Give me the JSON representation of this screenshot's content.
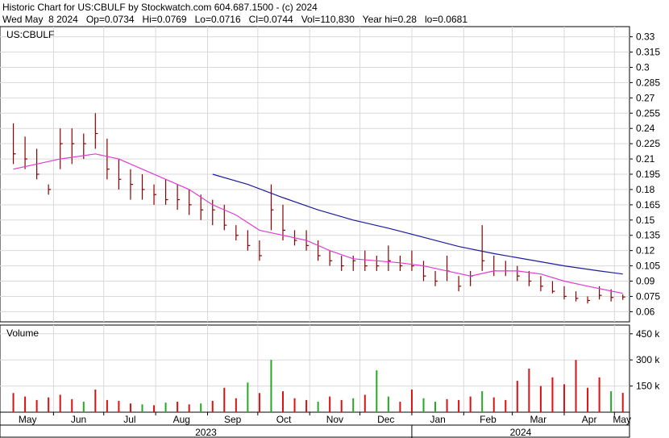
{
  "header": {
    "title": "Historic Chart for US:CBULF by Stockwatch.com 604.687.1500 - (c) 2024",
    "stats": "Wed May  8 2024   Op=0.0734   Hi=0.0769   Lo=0.0716   Cl=0.0744   Vol=110,830   Year hi=0.28   lo=0.0681"
  },
  "colors": {
    "price_bar": "#8b0000",
    "ma_short": "#e03cd0",
    "ma_long": "#1c1c9c",
    "vol_up": "#22aa22",
    "vol_down": "#dd1111",
    "grid": "#d9d9d9"
  },
  "chart_data": [
    {
      "type": "line",
      "panel_label": "US:CBULF",
      "ylim": [
        0.05,
        0.34
      ],
      "yticks": [
        "0.33",
        "0.315",
        "0.3",
        "0.285",
        "0.27",
        "0.255",
        "0.24",
        "0.225",
        "0.21",
        "0.195",
        "0.18",
        "0.165",
        "0.15",
        "0.135",
        "0.12",
        "0.105",
        "0.09",
        "0.075",
        "0.06"
      ],
      "series": [
        {
          "kind": "ohlc",
          "x": [
            "2023-05-08",
            "2023-05-15",
            "2023-05-22",
            "2023-05-29",
            "2023-06-05",
            "2023-06-12",
            "2023-06-19",
            "2023-06-26",
            "2023-07-03",
            "2023-07-10",
            "2023-07-17",
            "2023-07-24",
            "2023-07-31",
            "2023-08-07",
            "2023-08-14",
            "2023-08-21",
            "2023-08-28",
            "2023-09-04",
            "2023-09-11",
            "2023-09-18",
            "2023-09-25",
            "2023-10-02",
            "2023-10-09",
            "2023-10-16",
            "2023-10-23",
            "2023-10-30",
            "2023-11-06",
            "2023-11-13",
            "2023-11-20",
            "2023-11-27",
            "2023-12-04",
            "2023-12-11",
            "2023-12-18",
            "2023-12-25",
            "2024-01-01",
            "2024-01-08",
            "2024-01-15",
            "2024-01-22",
            "2024-01-29",
            "2024-02-05",
            "2024-02-12",
            "2024-02-19",
            "2024-02-26",
            "2024-03-04",
            "2024-03-11",
            "2024-03-18",
            "2024-03-25",
            "2024-04-01",
            "2024-04-08",
            "2024-04-15",
            "2024-04-22",
            "2024-04-29",
            "2024-05-06"
          ],
          "high": [
            0.245,
            0.232,
            0.22,
            0.185,
            0.24,
            0.24,
            0.235,
            0.255,
            0.23,
            0.21,
            0.2,
            0.195,
            0.185,
            0.19,
            0.185,
            0.18,
            0.175,
            0.17,
            0.165,
            0.145,
            0.14,
            0.13,
            0.185,
            0.165,
            0.14,
            0.14,
            0.13,
            0.12,
            0.115,
            0.115,
            0.12,
            0.115,
            0.125,
            0.115,
            0.12,
            0.11,
            0.1,
            0.115,
            0.095,
            0.1,
            0.145,
            0.115,
            0.11,
            0.105,
            0.1,
            0.095,
            0.09,
            0.085,
            0.08,
            0.075,
            0.085,
            0.082,
            0.0769
          ],
          "low": [
            0.205,
            0.2,
            0.19,
            0.175,
            0.2,
            0.205,
            0.21,
            0.22,
            0.19,
            0.18,
            0.17,
            0.17,
            0.165,
            0.165,
            0.16,
            0.155,
            0.15,
            0.145,
            0.14,
            0.13,
            0.12,
            0.11,
            0.14,
            0.13,
            0.125,
            0.12,
            0.11,
            0.105,
            0.1,
            0.1,
            0.1,
            0.1,
            0.1,
            0.1,
            0.1,
            0.09,
            0.085,
            0.09,
            0.08,
            0.085,
            0.1,
            0.095,
            0.095,
            0.09,
            0.085,
            0.08,
            0.078,
            0.072,
            0.07,
            0.068,
            0.072,
            0.07,
            0.0716
          ],
          "close": [
            0.215,
            0.21,
            0.195,
            0.18,
            0.225,
            0.225,
            0.225,
            0.235,
            0.2,
            0.19,
            0.185,
            0.18,
            0.175,
            0.17,
            0.17,
            0.165,
            0.16,
            0.16,
            0.145,
            0.135,
            0.125,
            0.115,
            0.16,
            0.14,
            0.13,
            0.125,
            0.115,
            0.11,
            0.105,
            0.11,
            0.105,
            0.105,
            0.11,
            0.105,
            0.105,
            0.095,
            0.09,
            0.1,
            0.085,
            0.095,
            0.11,
            0.1,
            0.1,
            0.095,
            0.09,
            0.085,
            0.08,
            0.075,
            0.073,
            0.071,
            0.076,
            0.074,
            0.0744
          ]
        },
        {
          "kind": "moving_average_short",
          "x": [
            "2023-05-08",
            "2023-06-05",
            "2023-06-26",
            "2023-07-10",
            "2023-07-24",
            "2023-08-07",
            "2023-08-21",
            "2023-09-04",
            "2023-09-18",
            "2023-10-02",
            "2023-10-16",
            "2023-10-30",
            "2023-11-13",
            "2023-11-27",
            "2023-12-11",
            "2023-12-25",
            "2024-01-08",
            "2024-01-22",
            "2024-02-05",
            "2024-02-19",
            "2024-03-04",
            "2024-03-18",
            "2024-04-01",
            "2024-04-15",
            "2024-05-06"
          ],
          "values": [
            0.2,
            0.21,
            0.215,
            0.21,
            0.2,
            0.19,
            0.18,
            0.165,
            0.155,
            0.14,
            0.135,
            0.13,
            0.12,
            0.112,
            0.11,
            0.108,
            0.105,
            0.1,
            0.095,
            0.1,
            0.1,
            0.097,
            0.09,
            0.085,
            0.078
          ]
        },
        {
          "kind": "moving_average_long",
          "x": [
            "2023-09-04",
            "2023-09-25",
            "2023-10-16",
            "2023-11-06",
            "2023-11-27",
            "2023-12-18",
            "2024-01-08",
            "2024-01-29",
            "2024-02-19",
            "2024-03-11",
            "2024-04-01",
            "2024-04-22",
            "2024-05-06"
          ],
          "values": [
            0.195,
            0.185,
            0.172,
            0.16,
            0.15,
            0.142,
            0.133,
            0.124,
            0.117,
            0.111,
            0.105,
            0.1,
            0.097
          ]
        }
      ],
      "grid": true
    },
    {
      "type": "bar",
      "panel_label": "Volume",
      "ylim": [
        0,
        500000
      ],
      "yticks": [
        "450 k",
        "300 k",
        "150 k"
      ],
      "x": [
        "2023-05-08",
        "2023-05-15",
        "2023-05-22",
        "2023-05-29",
        "2023-06-05",
        "2023-06-12",
        "2023-06-19",
        "2023-06-26",
        "2023-07-03",
        "2023-07-10",
        "2023-07-17",
        "2023-07-24",
        "2023-07-31",
        "2023-08-07",
        "2023-08-14",
        "2023-08-21",
        "2023-08-28",
        "2023-09-04",
        "2023-09-11",
        "2023-09-18",
        "2023-09-25",
        "2023-10-02",
        "2023-10-09",
        "2023-10-16",
        "2023-10-23",
        "2023-10-30",
        "2023-11-06",
        "2023-11-13",
        "2023-11-20",
        "2023-11-27",
        "2023-12-04",
        "2023-12-11",
        "2023-12-18",
        "2023-12-25",
        "2024-01-01",
        "2024-01-08",
        "2024-01-15",
        "2024-01-22",
        "2024-01-29",
        "2024-02-05",
        "2024-02-12",
        "2024-02-19",
        "2024-02-26",
        "2024-03-04",
        "2024-03-11",
        "2024-03-18",
        "2024-03-25",
        "2024-04-01",
        "2024-04-08",
        "2024-04-15",
        "2024-04-22",
        "2024-04-29",
        "2024-05-06"
      ],
      "values": [
        110000,
        90000,
        70000,
        85000,
        100000,
        75000,
        60000,
        130000,
        70000,
        65000,
        50000,
        45000,
        40000,
        55000,
        60000,
        45000,
        50000,
        65000,
        140000,
        80000,
        170000,
        110000,
        300000,
        120000,
        80000,
        70000,
        60000,
        90000,
        70000,
        80000,
        100000,
        240000,
        90000,
        60000,
        130000,
        80000,
        60000,
        75000,
        70000,
        90000,
        120000,
        85000,
        70000,
        180000,
        250000,
        150000,
        200000,
        160000,
        300000,
        140000,
        200000,
        120000,
        110830
      ],
      "up": [
        false,
        false,
        false,
        false,
        false,
        false,
        true,
        false,
        false,
        false,
        false,
        true,
        false,
        true,
        false,
        false,
        true,
        false,
        false,
        false,
        true,
        false,
        true,
        false,
        false,
        false,
        true,
        false,
        false,
        true,
        false,
        true,
        true,
        false,
        false,
        true,
        true,
        false,
        false,
        false,
        true,
        false,
        false,
        false,
        false,
        false,
        false,
        false,
        false,
        false,
        false,
        true,
        false
      ]
    }
  ],
  "x_axis": {
    "months": [
      "May",
      "Jun",
      "Jul",
      "Aug",
      "Sep",
      "Oct",
      "Nov",
      "Dec",
      "Jan",
      "Feb",
      "Mar",
      "Apr",
      "May"
    ],
    "years": [
      "2023",
      "2024"
    ]
  }
}
